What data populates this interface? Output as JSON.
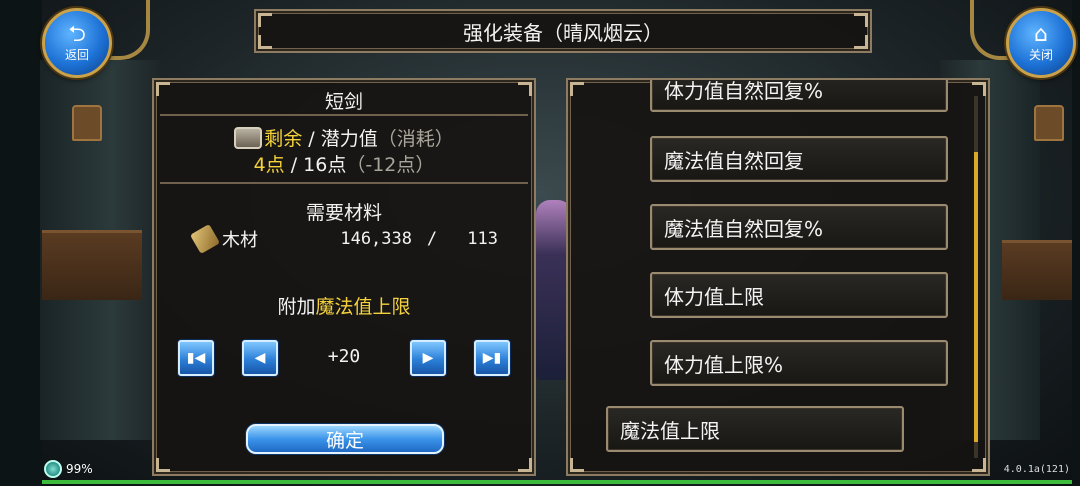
{
  "nav": {
    "back_label": "返回",
    "close_label": "关闭"
  },
  "title": "强化装备（晴风烟云）",
  "item": {
    "name": "短剑"
  },
  "potential": {
    "remaining_label": "剩余",
    "separator": " / ",
    "potential_label": "潜力值",
    "consume_label": "（消耗）",
    "remaining_value": "4点",
    "total_value": "16点",
    "consume_value": "（-12点）"
  },
  "materials": {
    "title": "需要材料",
    "items": [
      {
        "name": "木材",
        "have": "146,338",
        "sep": "/",
        "need": "113",
        "icon": "wood-icon"
      }
    ]
  },
  "add_stat": {
    "prefix": "附加",
    "stat": "魔法值上限"
  },
  "stepper": {
    "value": "+20",
    "first_icon": "skip-to-first-icon",
    "prev_icon": "previous-icon",
    "next_icon": "next-icon",
    "last_icon": "skip-to-last-icon"
  },
  "confirm_label": "确定",
  "stat_list": [
    {
      "label": "体力值自然回复%"
    },
    {
      "label": "魔法值自然回复"
    },
    {
      "label": "魔法值自然回复%"
    },
    {
      "label": "体力值上限"
    },
    {
      "label": "体力值上限%"
    },
    {
      "label": "魔法值上限"
    }
  ],
  "status": {
    "battery": "99%",
    "version": "4.0.1a(121)"
  },
  "colors": {
    "highlight": "#f4d23c",
    "button_blue": "#2c7fd8",
    "frame": "#8d7c62",
    "exp_green": "#3dbb3d"
  }
}
